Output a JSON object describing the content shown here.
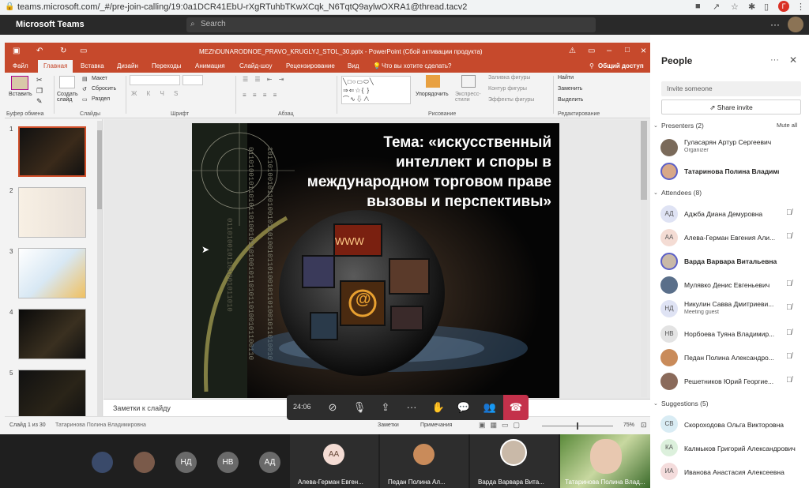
{
  "browser": {
    "url": "teams.microsoft.com/_#/pre-join-calling/19:0a1DCR41EbU-rXgRTuhbTKwXCqk_N6TqtQ9aylwOXRA1@thread.tacv2",
    "avatar_initial": "Г"
  },
  "teams": {
    "app_title": "Microsoft Teams",
    "search_placeholder": "Search",
    "more": "···"
  },
  "ppt": {
    "file_title": "MEZhDUNARODNOE_PRAVO_KRUGLYJ_STOL_30.pptx - PowerPoint (Сбой активации продукта)",
    "share": "Общий доступ",
    "tabs": [
      "Файл",
      "Главная",
      "Вставка",
      "Дизайн",
      "Переходы",
      "Анимация",
      "Слайд-шоу",
      "Рецензирование",
      "Вид"
    ],
    "tell_me": "Что вы хотите сделать?",
    "ribbon": {
      "paste": "Вставить",
      "create_slide": "Создать слайд",
      "layout": "Макет",
      "reset": "Сбросить",
      "section": "Раздел",
      "groups": [
        "Буфер обмена",
        "Слайды",
        "Шрифт",
        "Абзац",
        "Рисование",
        "Редактирование"
      ],
      "arrange": "Упорядочить",
      "styles": "Экспресс-стили",
      "fill": "Заливка фигуры",
      "outline": "Контур фигуры",
      "effects": "Эффекты фигуры",
      "find": "Найти",
      "replace": "Заменить",
      "select": "Выделить"
    },
    "slide_numbers": [
      "1",
      "2",
      "3",
      "4",
      "5"
    ],
    "slide_title": [
      "Тема: «искусственный",
      "интеллект и споры в",
      "международном торговом праве",
      "вызовы и перспективы»"
    ],
    "slide_www": "WWW",
    "slide_at": "@",
    "notes_placeholder": "Заметки к слайду",
    "status_left": "Слайд 1 из 30",
    "status_overlay": "Татаринова Полина Владимировна",
    "status_notes": "Заметки",
    "status_comments": "Примечания",
    "zoom": "75%"
  },
  "call": {
    "timer": "24:06"
  },
  "people": {
    "title": "People",
    "invite_placeholder": "Invite someone",
    "share_invite": "Share invite",
    "presenters_header": "Presenters (2)",
    "mute_all": "Mute all",
    "presenters": [
      {
        "name": "Гуласарян Артур Сергеевич",
        "sub": "Organizer"
      },
      {
        "name": "Татаринова Полина Владими..."
      }
    ],
    "attendees_header": "Attendees (8)",
    "attendees": [
      {
        "initials": "АД",
        "name": "Аджба Диана Демуровна",
        "color": "#dfe3f4"
      },
      {
        "initials": "АА",
        "name": "Алева-Герман Евгения Али...",
        "color": "#f4dcd4"
      },
      {
        "initials": "",
        "name": "Варда Варвара Витальевна",
        "color": "#c9b9a8"
      },
      {
        "initials": "",
        "name": "Мулявко Денис Евгеньевич",
        "color": "#5a6f8a"
      },
      {
        "initials": "НД",
        "name": "Никулин Савва Дмитриеви...",
        "sub": "Meeting guest",
        "color": "#dfe3f4"
      },
      {
        "initials": "НВ",
        "name": "Норбоева Туяна Владимир...",
        "color": "#e3e3e3"
      },
      {
        "initials": "",
        "name": "Педан Полина Александро...",
        "color": "#c98b5a"
      },
      {
        "initials": "",
        "name": "Решетников Юрий Георгие...",
        "color": "#8a6a5a"
      }
    ],
    "suggestions_header": "Suggestions (5)",
    "suggestions": [
      {
        "initials": "СВ",
        "name": "Скороходова Ольга Викторовна",
        "color": "#d9ecf4"
      },
      {
        "initials": "КА",
        "name": "Калмыков Григорий Александрович",
        "color": "#dcf0dc"
      },
      {
        "initials": "ИА",
        "name": "Иванова Анастасия Алексеевна",
        "color": "#f4dcdc"
      }
    ]
  },
  "strip": {
    "circles": [
      "НД",
      "НВ",
      "АД"
    ],
    "tiles": [
      {
        "initials": "АА",
        "label": "Алева-Герман Евген..."
      },
      {
        "initials": "",
        "label": "Педан Полина Ал..."
      },
      {
        "initials": "",
        "label": "Варда Варвара Вита..."
      },
      {
        "initials": "",
        "label": "Татаринова Полина Влад..."
      }
    ]
  }
}
